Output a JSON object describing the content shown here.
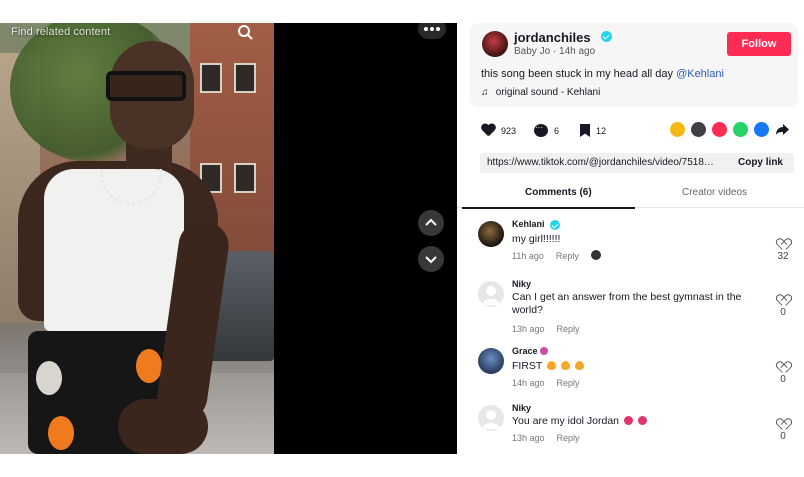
{
  "video": {
    "overlay_label": "Find related content"
  },
  "post": {
    "author": "jordanchiles",
    "nickname": "Baby Jo",
    "time_ago": "14h ago",
    "meta_separator": " · ",
    "follow_label": "Follow",
    "caption_text": "this song been stuck in my head all day ",
    "caption_mention": "@Kehlani",
    "music": "original sound - Kehlani"
  },
  "stats": {
    "likes": "923",
    "comments": "6",
    "saves": "12"
  },
  "share_icons": [
    {
      "name": "repost-icon",
      "color": "#f4b915"
    },
    {
      "name": "embed-icon",
      "color": "#3f3f46"
    },
    {
      "name": "send-icon",
      "color": "#fe2c55"
    },
    {
      "name": "whatsapp-icon",
      "color": "#25d366"
    },
    {
      "name": "facebook-icon",
      "color": "#1877f2"
    }
  ],
  "link": {
    "url": "https://www.tiktok.com/@jordanchiles/video/75189038...",
    "copy_label": "Copy link"
  },
  "tabs": {
    "comments_label": "Comments (6)",
    "creator_videos_label": "Creator videos"
  },
  "comments": [
    {
      "name": "Kehlani",
      "text": "my girl!!!!!!",
      "time": "11h ago",
      "reply": "Reply",
      "likes": "32"
    },
    {
      "name": "Niky",
      "text": "Can I get an answer from the best gymnast in the world?",
      "time": "13h ago",
      "reply": "Reply",
      "likes": "0"
    },
    {
      "name": "Grace",
      "text": "FIRST",
      "time": "14h ago",
      "reply": "Reply",
      "likes": "0"
    },
    {
      "name": "Niky",
      "text": "You are my idol Jordan",
      "time": "13h ago",
      "reply": "Reply",
      "likes": "0"
    }
  ],
  "colors": {
    "accent": "#fe2c55",
    "verified": "#20d5ec",
    "mention": "#2b5db9"
  }
}
